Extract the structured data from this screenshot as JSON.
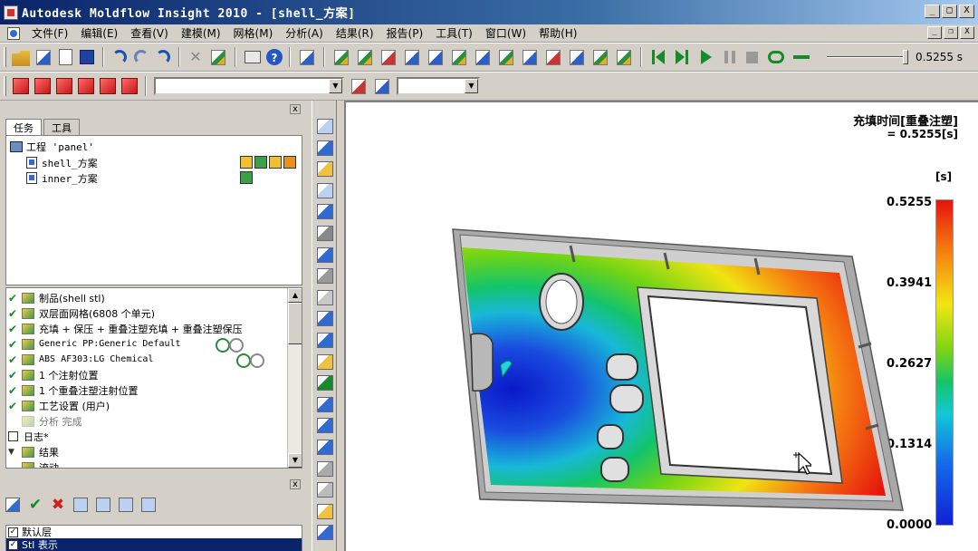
{
  "window": {
    "title": "Autodesk Moldflow Insight 2010 - [shell_方案]",
    "btn_min": "_",
    "btn_max": "□",
    "btn_close": "X"
  },
  "menu": [
    "文件(F)",
    "编辑(E)",
    "查看(V)",
    "建模(M)",
    "网格(M)",
    "分析(A)",
    "结果(R)",
    "报告(P)",
    "工具(T)",
    "窗口(W)",
    "帮助(H)"
  ],
  "mdi": {
    "min": "_",
    "restore": "❐",
    "close": "X"
  },
  "animation": {
    "time_readout": "0.5255 s",
    "slider_position": 1.0
  },
  "left_panel": {
    "close": "x",
    "tabs": [
      "任务",
      "工具"
    ],
    "project": {
      "name": "工程 'panel'",
      "studies": [
        {
          "name": "shell_方案",
          "status_boxes": 4
        },
        {
          "name": "inner_方案",
          "status_boxes": 1
        }
      ]
    },
    "tasks": [
      {
        "label": "制品(shell stl)",
        "checked": true,
        "mono": false,
        "grey": false,
        "extra": ""
      },
      {
        "label": "双层面网格(6808 个单元)",
        "checked": true,
        "mono": false,
        "grey": false,
        "extra": ""
      },
      {
        "label": "充填 + 保压 + 重叠注塑充填 + 重叠注塑保压",
        "checked": true,
        "mono": false,
        "grey": false,
        "extra": ""
      },
      {
        "label": "Generic PP:Generic Default",
        "checked": true,
        "mono": true,
        "grey": false,
        "extra": "recycle"
      },
      {
        "label": "ABS AF303:LG Chemical",
        "checked": true,
        "mono": true,
        "grey": false,
        "extra": "recycle"
      },
      {
        "label": "1 个注射位置",
        "checked": true,
        "mono": false,
        "grey": false,
        "extra": ""
      },
      {
        "label": "1 个重叠注塑注射位置",
        "checked": true,
        "mono": false,
        "grey": false,
        "extra": ""
      },
      {
        "label": "工艺设置 (用户)",
        "checked": true,
        "mono": false,
        "grey": false,
        "extra": ""
      },
      {
        "label": "分析 完成",
        "checked": false,
        "mono": false,
        "grey": true,
        "extra": ""
      },
      {
        "label": "日志*",
        "checked": false,
        "mono": false,
        "grey": false,
        "extra": "box"
      },
      {
        "label": "结果",
        "checked": false,
        "mono": false,
        "grey": false,
        "extra": "expand"
      },
      {
        "label": "流动",
        "checked": false,
        "mono": false,
        "grey": false,
        "extra": ""
      }
    ],
    "layers_close": "x",
    "layers": [
      {
        "label": "默认层",
        "checked": true,
        "selected": false
      },
      {
        "label": "Stl 表示",
        "checked": true,
        "selected": true
      }
    ]
  },
  "plot": {
    "title": "充填时间[重叠注塑]",
    "subtitle": "= 0.5255[s]",
    "unit": "[s]",
    "ticks": [
      "0.5255",
      "0.3941",
      "0.2627",
      "0.1314",
      "0.0000"
    ]
  },
  "icons": {
    "open": "open-icon",
    "new": "new-file-icon",
    "save": "save-icon",
    "undo": "undo-icon",
    "redo": "redo-icon",
    "print": "print-icon",
    "help": "help-icon",
    "play": "play-icon",
    "pause": "pause-icon",
    "stop": "stop-icon"
  },
  "colors": {
    "titlebar": "#0a246a",
    "accent_green": "#168a2a",
    "selected_row": "#0a246a"
  }
}
